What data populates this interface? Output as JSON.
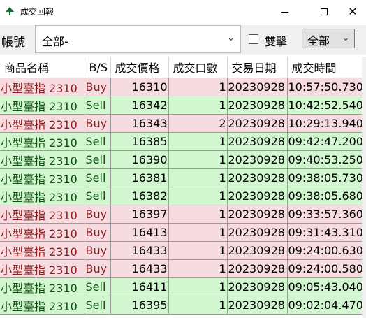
{
  "window": {
    "title": "成交回報",
    "close_glyph": "✕",
    "icon": "tree-icon"
  },
  "filter": {
    "account_label": "帳號",
    "account_value": "全部-",
    "double_click_label": "雙擊",
    "double_click_checked": false,
    "scope_value": "全部"
  },
  "table": {
    "headers": [
      "商品名稱",
      "B/S",
      "成交價格",
      "成交口數",
      "交易日期",
      "成交時間"
    ],
    "rows": [
      {
        "name": "小型臺指 2310",
        "side": "Buy",
        "price": "16310",
        "qty": "1",
        "date": "20230928",
        "time": "10:57:50.730"
      },
      {
        "name": "小型臺指 2310",
        "side": "Sell",
        "price": "16342",
        "qty": "1",
        "date": "20230928",
        "time": "10:42:52.540"
      },
      {
        "name": "小型臺指 2310",
        "side": "Buy",
        "price": "16343",
        "qty": "2",
        "date": "20230928",
        "time": "10:29:13.940"
      },
      {
        "name": "小型臺指 2310",
        "side": "Sell",
        "price": "16385",
        "qty": "1",
        "date": "20230928",
        "time": "09:42:47.200"
      },
      {
        "name": "小型臺指 2310",
        "side": "Sell",
        "price": "16390",
        "qty": "1",
        "date": "20230928",
        "time": "09:40:53.250"
      },
      {
        "name": "小型臺指 2310",
        "side": "Sell",
        "price": "16381",
        "qty": "1",
        "date": "20230928",
        "time": "09:38:05.730"
      },
      {
        "name": "小型臺指 2310",
        "side": "Sell",
        "price": "16382",
        "qty": "1",
        "date": "20230928",
        "time": "09:38:05.680"
      },
      {
        "name": "小型臺指 2310",
        "side": "Buy",
        "price": "16397",
        "qty": "1",
        "date": "20230928",
        "time": "09:33:57.360"
      },
      {
        "name": "小型臺指 2310",
        "side": "Buy",
        "price": "16413",
        "qty": "1",
        "date": "20230928",
        "time": "09:31:43.310"
      },
      {
        "name": "小型臺指 2310",
        "side": "Buy",
        "price": "16433",
        "qty": "1",
        "date": "20230928",
        "time": "09:24:00.630"
      },
      {
        "name": "小型臺指 2310",
        "side": "Buy",
        "price": "16433",
        "qty": "1",
        "date": "20230928",
        "time": "09:24:00.580"
      },
      {
        "name": "小型臺指 2310",
        "side": "Sell",
        "price": "16411",
        "qty": "1",
        "date": "20230928",
        "time": "09:05:43.040"
      },
      {
        "name": "小型臺指 2310",
        "side": "Sell",
        "price": "16395",
        "qty": "1",
        "date": "20230928",
        "time": "09:02:04.470"
      }
    ]
  },
  "colors": {
    "buy_row": "#f6dbe0",
    "sell_row": "#d2f6d0",
    "buy_text": "#8b1d1d",
    "sell_text": "#0d4f0d"
  }
}
